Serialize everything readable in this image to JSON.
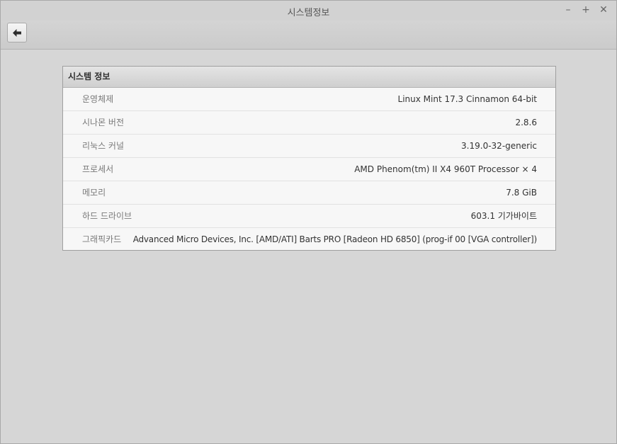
{
  "window": {
    "title": "시스템정보",
    "controls": {
      "minimize": "–",
      "maximize": "+",
      "close": "✕"
    }
  },
  "toolbar": {
    "back_icon": "arrow-left-icon"
  },
  "panel": {
    "header": "시스템 정보",
    "rows": [
      {
        "label": "운영체제",
        "value": "Linux Mint 17.3 Cinnamon 64-bit"
      },
      {
        "label": "시나몬 버전",
        "value": "2.8.6"
      },
      {
        "label": "리눅스 커널",
        "value": "3.19.0-32-generic"
      },
      {
        "label": "프로세서",
        "value": "AMD Phenom(tm) II X4 960T Processor × 4"
      },
      {
        "label": "메모리",
        "value": "7.8 GiB"
      },
      {
        "label": "하드 드라이브",
        "value": "603.1 기가바이트"
      },
      {
        "label": "그래픽카드",
        "value": "Advanced Micro Devices, Inc. [AMD/ATI] Barts PRO [Radeon HD 6850] (prog-if 00 [VGA controller])"
      }
    ]
  }
}
